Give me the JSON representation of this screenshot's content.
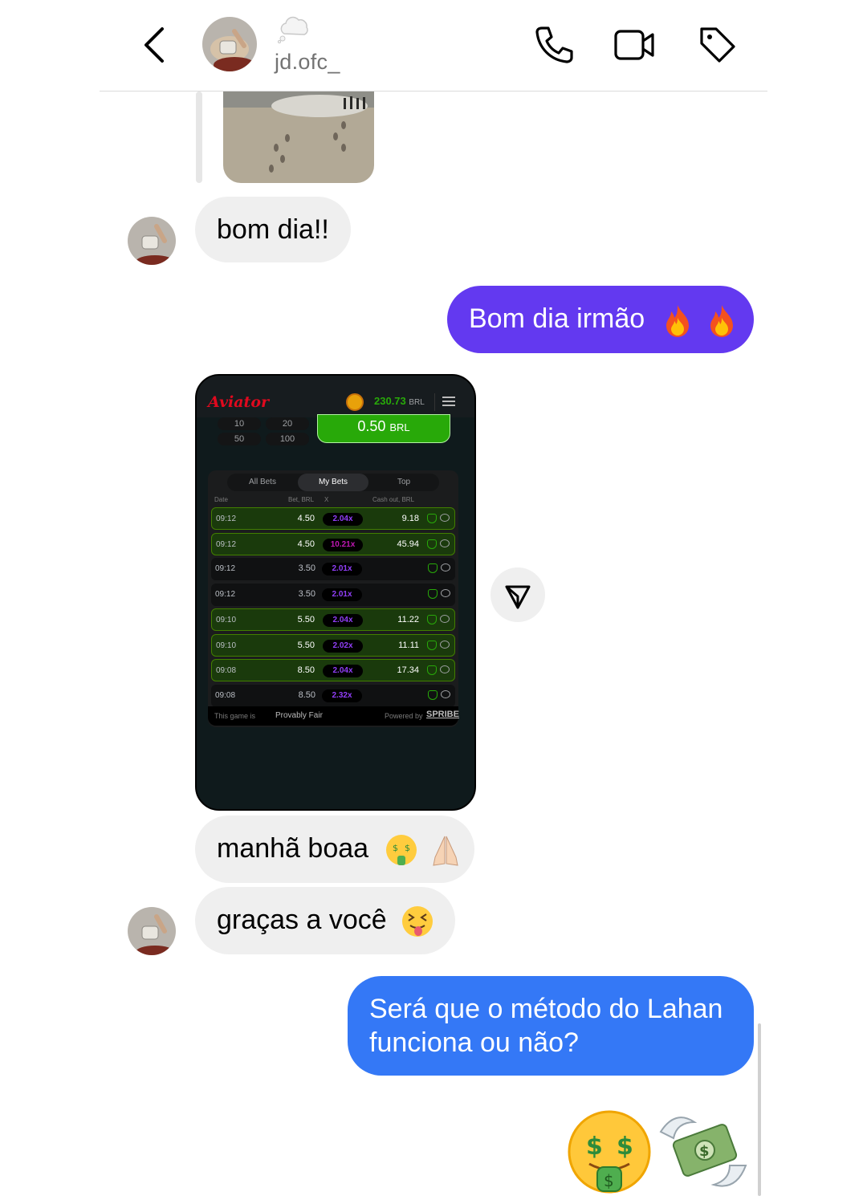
{
  "header": {
    "username": "jd.ofc_",
    "icons": [
      "back-arrow-icon",
      "audio-call-icon",
      "video-call-icon",
      "tag-icon"
    ]
  },
  "messages": [
    {
      "side": "in",
      "text": "bom dia!!"
    },
    {
      "side": "out",
      "text": "Bom dia irmão",
      "emoji": [
        "fire",
        "fire"
      ]
    },
    {
      "side": "in",
      "text": "manhã boaa",
      "emoji": [
        "money-mouth-face",
        "folded-hands"
      ]
    },
    {
      "side": "in",
      "text": "graças a você",
      "emoji": [
        "squinting-tongue-face"
      ]
    },
    {
      "side": "out",
      "text": "Será que o método do Lahan funciona ou não?"
    },
    {
      "side": "out",
      "emoji": [
        "money-mouth-face",
        "money-with-wings"
      ]
    }
  ],
  "game": {
    "logo": "Aviator",
    "balance": "230.73",
    "currency": "BRL",
    "quick_amounts": [
      "10",
      "20",
      "50",
      "100"
    ],
    "bet_amount": "0.50",
    "tabs": [
      "All Bets",
      "My Bets",
      "Top"
    ],
    "active_tab": "My Bets",
    "columns": {
      "date": "Date",
      "bet": "Bet, BRL",
      "x": "X",
      "cashout": "Cash out, BRL"
    },
    "rows": [
      {
        "time": "09:12",
        "bet": "4.50",
        "mult": "2.04x",
        "cashout": "9.18",
        "win": true,
        "color": "#913ef8"
      },
      {
        "time": "09:12",
        "bet": "4.50",
        "mult": "10.21x",
        "cashout": "45.94",
        "win": true,
        "color": "#c017b4"
      },
      {
        "time": "09:12",
        "bet": "3.50",
        "mult": "2.01x",
        "cashout": "",
        "win": false,
        "color": "#913ef8"
      },
      {
        "time": "09:12",
        "bet": "3.50",
        "mult": "2.01x",
        "cashout": "",
        "win": false,
        "color": "#913ef8"
      },
      {
        "time": "09:10",
        "bet": "5.50",
        "mult": "2.04x",
        "cashout": "11.22",
        "win": true,
        "color": "#913ef8"
      },
      {
        "time": "09:10",
        "bet": "5.50",
        "mult": "2.02x",
        "cashout": "11.11",
        "win": true,
        "color": "#913ef8"
      },
      {
        "time": "09:08",
        "bet": "8.50",
        "mult": "2.04x",
        "cashout": "17.34",
        "win": true,
        "color": "#913ef8"
      },
      {
        "time": "09:08",
        "bet": "8.50",
        "mult": "2.32x",
        "cashout": "",
        "win": false,
        "color": "#913ef8"
      }
    ],
    "footer": {
      "game_is": "This game is",
      "fair": "Provably Fair",
      "powered": "Powered by",
      "brand": "SPRIBE"
    }
  },
  "colors": {
    "purple_bubble": "#6339f0",
    "blue_bubble": "#3478f6",
    "incoming_bubble": "#efefef"
  }
}
